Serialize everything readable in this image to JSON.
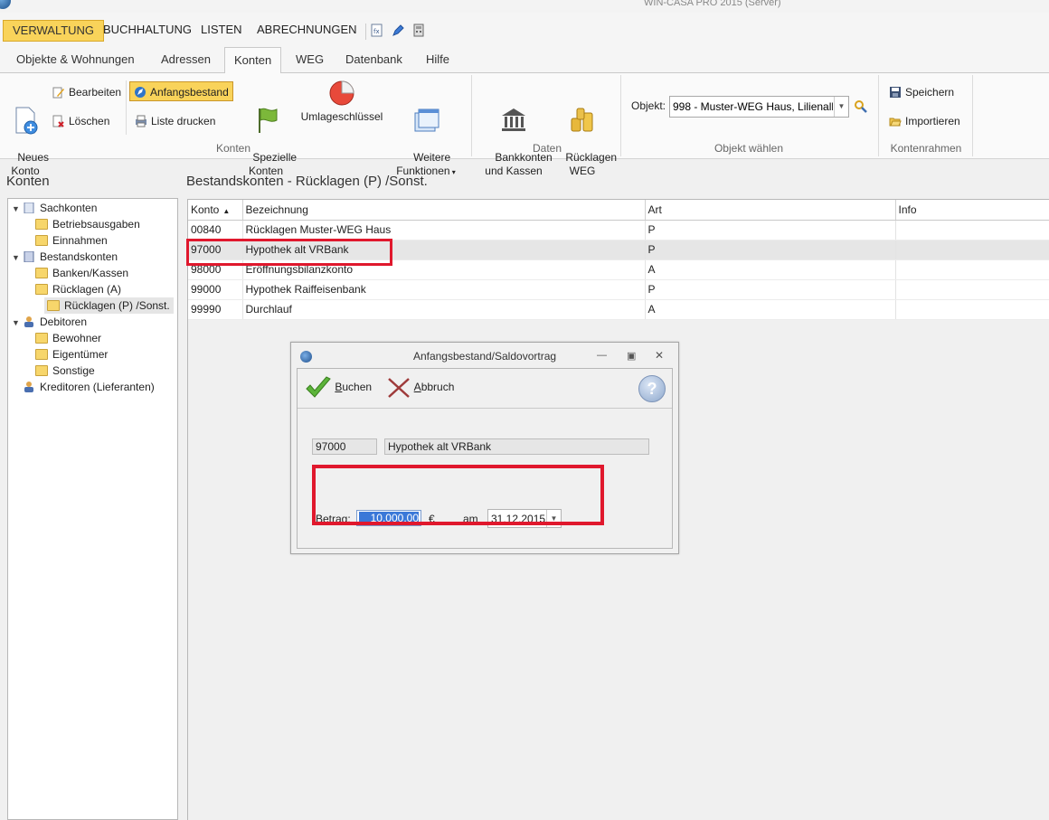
{
  "window": {
    "title": "WIN-CASA PRO 2015 (Server)"
  },
  "modules": [
    "VERWALTUNG",
    "BUCHHALTUNG",
    "LISTEN",
    "ABRECHNUNGEN"
  ],
  "ribbon_tabs": [
    "Objekte & Wohnungen",
    "Adressen",
    "Konten",
    "WEG",
    "Datenbank",
    "Hilfe"
  ],
  "ribbon": {
    "konten_group": {
      "label": "Konten",
      "neues_konto": "Neues\nKonto",
      "bearbeiten": "Bearbeiten",
      "loeschen": "Löschen",
      "anfangsbestand": "Anfangsbestand",
      "liste_drucken": "Liste drucken",
      "spezielle_konten": "Spezielle\nKonten",
      "umlageschluessel": "Umlageschlüssel",
      "weitere_funktionen": "Weitere\nFunktionen"
    },
    "daten_group": {
      "label": "Daten",
      "bankkonten": "Bankkonten\nund Kassen",
      "ruecklagen_weg": "Rücklagen\nWEG"
    },
    "objekt_group": {
      "label": "Objekt  wählen",
      "objekt_label": "Objekt:",
      "objekt_value": "998 - Muster-WEG Haus, Lilienalle"
    },
    "kontenrahmen_group": {
      "label": "Kontenrahmen",
      "speichern": "Speichern",
      "importieren": "Importieren"
    }
  },
  "left_panel": {
    "title": "Konten",
    "tree": [
      {
        "label": "Sachkonten",
        "level": 0,
        "expanded": true
      },
      {
        "label": "Betriebsausgaben",
        "level": 1
      },
      {
        "label": "Einnahmen",
        "level": 1
      },
      {
        "label": "Bestandskonten",
        "level": 0,
        "expanded": true
      },
      {
        "label": "Banken/Kassen",
        "level": 1
      },
      {
        "label": "Rücklagen (A)",
        "level": 1
      },
      {
        "label": "Rücklagen (P) /Sonst.",
        "level": 1,
        "selected": true
      },
      {
        "label": "Debitoren",
        "level": 0,
        "expanded": true
      },
      {
        "label": "Bewohner",
        "level": 1
      },
      {
        "label": "Eigentümer",
        "level": 1
      },
      {
        "label": "Sonstige",
        "level": 1
      },
      {
        "label": "Kreditoren (Lieferanten)",
        "level": 0
      }
    ]
  },
  "content": {
    "title": "Bestandskonten - Rücklagen (P) /Sonst.",
    "columns": [
      "Konto",
      "Bezeichnung",
      "Art",
      "Info"
    ],
    "rows": [
      {
        "konto": "00840",
        "bezeichnung": "Rücklagen Muster-WEG Haus",
        "art": "P",
        "info": ""
      },
      {
        "konto": "97000",
        "bezeichnung": "Hypothek alt VRBank",
        "art": "P",
        "info": "",
        "selected": true
      },
      {
        "konto": "98000",
        "bezeichnung": "Eröffnungsbilanzkonto",
        "art": "A",
        "info": ""
      },
      {
        "konto": "99000",
        "bezeichnung": "Hypothek Raiffeisenbank",
        "art": "P",
        "info": ""
      },
      {
        "konto": "99990",
        "bezeichnung": "Durchlauf",
        "art": "A",
        "info": ""
      }
    ]
  },
  "dialog": {
    "title": "Anfangsbestand/Saldovortrag",
    "buchen_label": "uchen",
    "buchen_accel": "B",
    "abbruch_label": "bbruch",
    "abbruch_accel": "A",
    "help_glyph": "?",
    "konto": "97000",
    "bezeichnung": "Hypothek alt VRBank",
    "betrag_label": "Betrag:",
    "betrag_value": "10.000,00",
    "currency": "€",
    "am_label": "am",
    "date_value": "31.12.2015"
  },
  "colors": {
    "accent_yellow": "#f9d35a",
    "highlight_red": "#e0182d",
    "selection_blue": "#3a78d8"
  }
}
